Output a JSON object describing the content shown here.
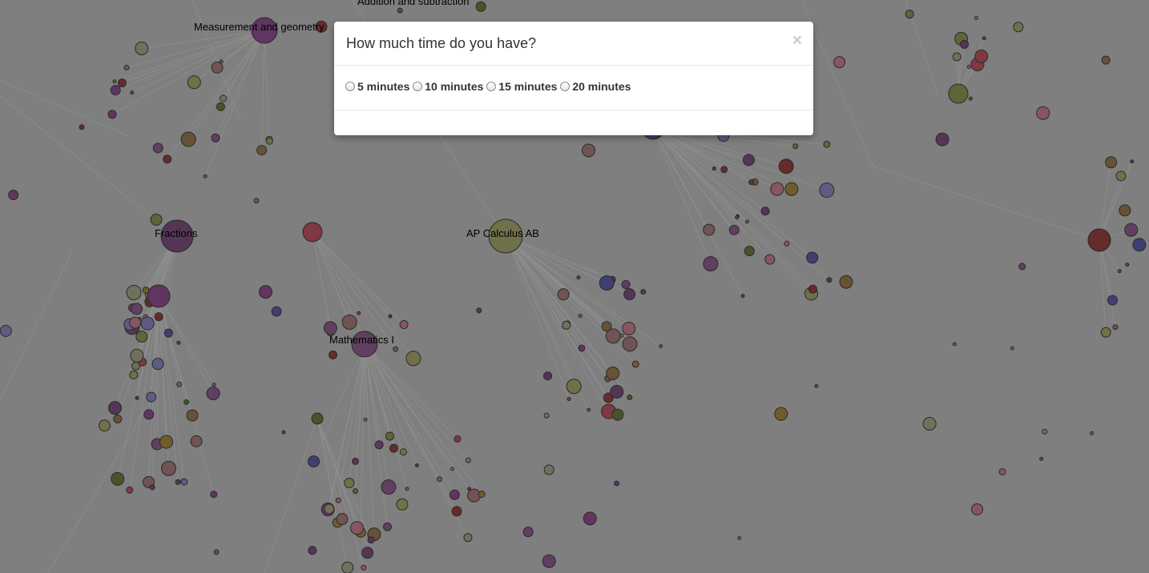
{
  "modal": {
    "title": "How much time do you have?",
    "close_symbol": "×",
    "options": [
      {
        "label": "5 minutes",
        "selected": false
      },
      {
        "label": "10 minutes",
        "selected": false
      },
      {
        "label": "15 minutes",
        "selected": false
      },
      {
        "label": "20 minutes",
        "selected": false
      }
    ]
  },
  "graph": {
    "labels": [
      "Measurement and geometry",
      "Addition and subtraction",
      "Fractions",
      "AP Calculus AB",
      "Mathematics I"
    ],
    "node_palette": [
      "#7f3a7f",
      "#7f4a7f",
      "#6e3a6e",
      "#9a9a5a",
      "#7a8a40",
      "#9a7a2a",
      "#b04050",
      "#8a2a2a",
      "#4a4a9a",
      "#7a7aba",
      "#9a6a6a",
      "#c07080",
      "#5a6a2a",
      "#8a6a3a",
      "#9a9a7a"
    ]
  }
}
